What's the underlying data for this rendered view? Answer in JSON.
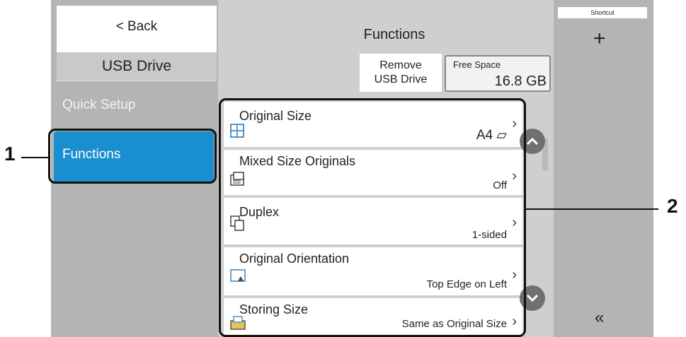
{
  "nav": {
    "back_label": "< Back",
    "section_title": "USB Drive",
    "items": [
      {
        "label": "Quick Setup",
        "selected": false
      },
      {
        "label": "Functions",
        "selected": true
      }
    ]
  },
  "header": {
    "title": "Functions",
    "remove_usb_label_line1": "Remove",
    "remove_usb_label_line2": "USB Drive",
    "free_space_label": "Free Space",
    "free_space_value": "16.8 GB"
  },
  "functions": [
    {
      "name": "Original Size",
      "value": "A4 ⏥",
      "icon": "original-size-icon"
    },
    {
      "name": "Mixed Size Originals",
      "value": "Off",
      "icon": "mixed-size-icon"
    },
    {
      "name": "Duplex",
      "value": "1-sided",
      "icon": "duplex-icon"
    },
    {
      "name": "Original Orientation",
      "value": "Top Edge on Left",
      "icon": "orientation-icon"
    },
    {
      "name": "Storing Size",
      "value": "Same as Original Size",
      "icon": "storing-size-icon"
    }
  ],
  "shortcut": {
    "label": "Shortcut",
    "add_symbol": "+",
    "collapse_symbol": "«"
  },
  "callouts": {
    "one": "1",
    "two": "2"
  },
  "colors": {
    "accent": "#1a8fd0",
    "panel": "#b4b4b4",
    "background": "#cfcfcf"
  }
}
